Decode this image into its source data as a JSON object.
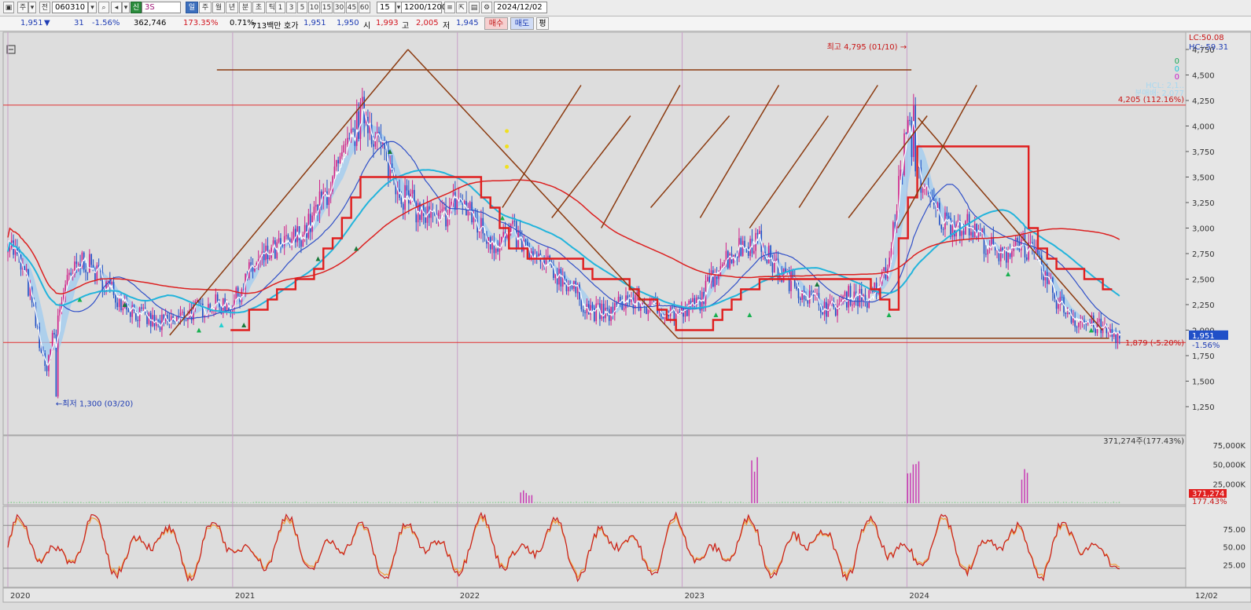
{
  "toolbar": {
    "code": "060310",
    "market_badge": "신",
    "name": "3S",
    "periods": [
      "일",
      "주",
      "월",
      "년",
      "분",
      "초",
      "틱"
    ],
    "active_period": "일",
    "intervals": [
      "1",
      "3",
      "5",
      "10",
      "15",
      "30",
      "45",
      "60"
    ],
    "interval_value": "15",
    "count": "1200/1200",
    "date": "2024/12/02",
    "left_labels": [
      "주",
      "전"
    ]
  },
  "quote": {
    "price": "1,951",
    "change_arrow": "▼",
    "change": "31",
    "change_pct": "-1.56%",
    "volume": "362,746",
    "volume_ratio": "173.35%",
    "turnover": "0.71%",
    "amount": "713백만",
    "bid_label": "호가",
    "ask": "1,951",
    "bid": "1,950",
    "open_label": "시",
    "open": "1,993",
    "high_label": "고",
    "high": "2,005",
    "low_label": "저",
    "low": "1,945",
    "buy_label": "매수",
    "sell_label": "매도",
    "eval_label": "평"
  },
  "main_panel": {
    "lc_label": "LC:50.08",
    "hc_label": "HC:-59.31",
    "legend_values": [
      "0",
      "0",
      "0"
    ],
    "legend_faded": [
      "HCL: 2,1..",
      "분매배: 2,077"
    ],
    "max_annotation": "최고 4,795 (01/10) →",
    "min_annotation": "←최저 1,300 (03/20)",
    "hline_upper_label": "4,205 (112.16%)",
    "hline_lower_label": "1,879 (-5.20%)",
    "price_badge": "1,951",
    "price_badge_sub": "-1.56%",
    "y_ticks": [
      "4,750",
      "4,500",
      "4,250",
      "4,000",
      "3,750",
      "3,500",
      "3,250",
      "3,000",
      "2,750",
      "2,500",
      "2,250",
      "2,000",
      "1,750",
      "1,500",
      "1,250"
    ]
  },
  "volume_panel": {
    "header": "371,274주(177.43%)",
    "y_ticks": [
      "75,000K",
      "50,000K",
      "25,000K"
    ],
    "badge": "371,274",
    "badge_sub": "177.43%"
  },
  "stoch_panel": {
    "y_ticks": [
      "75.00",
      "50.00",
      "25.00"
    ]
  },
  "x_axis": {
    "labels": [
      "2020",
      "2021",
      "2022",
      "2023",
      "2024",
      "12/02"
    ]
  },
  "colors": {
    "candle_body": "#d0208a",
    "ma_short": "#3050c8",
    "ma_long": "#22b4dc",
    "ma_red": "#dc2020",
    "trend": "#8b3a0f",
    "cloud": "#9ecbf0",
    "cloud_light": "#d4f4fa",
    "stoch_k": "#c81e1e",
    "stoch_d": "#f0a03c"
  },
  "chart_data": {
    "type": "candlestick",
    "x_range": [
      "2020-01",
      "2024-12-02"
    ],
    "ylim": [
      1250,
      4750
    ],
    "x": [
      "2020-01",
      "2020-02",
      "2020-03",
      "2020-04",
      "2020-05",
      "2020-06",
      "2020-07",
      "2020-08",
      "2020-09",
      "2020-10",
      "2020-11",
      "2020-12",
      "2021-01",
      "2021-02",
      "2021-03",
      "2021-04",
      "2021-05",
      "2021-06",
      "2021-07",
      "2021-08",
      "2021-09",
      "2021-10",
      "2021-11",
      "2021-12",
      "2022-01",
      "2022-02",
      "2022-03",
      "2022-04",
      "2022-05",
      "2022-06",
      "2022-07",
      "2022-08",
      "2022-09",
      "2022-10",
      "2022-11",
      "2022-12",
      "2023-01",
      "2023-02",
      "2023-03",
      "2023-04",
      "2023-05",
      "2023-06",
      "2023-07",
      "2023-08",
      "2023-09",
      "2023-10",
      "2023-11",
      "2023-12",
      "2024-01",
      "2024-02",
      "2024-03",
      "2024-04",
      "2024-05",
      "2024-06",
      "2024-07",
      "2024-08",
      "2024-09",
      "2024-10",
      "2024-11",
      "2024-12"
    ],
    "close": [
      2900,
      2500,
      1600,
      2400,
      2700,
      2500,
      2300,
      2150,
      2050,
      2100,
      2200,
      2250,
      2250,
      2600,
      2750,
      2850,
      3000,
      3350,
      3700,
      4150,
      3750,
      3350,
      3150,
      3050,
      3300,
      3050,
      2850,
      2950,
      2700,
      2600,
      2450,
      2200,
      2150,
      2300,
      2250,
      2200,
      2150,
      2300,
      2650,
      2800,
      2900,
      2600,
      2450,
      2300,
      2200,
      2350,
      2300,
      2600,
      4000,
      3300,
      3050,
      3050,
      2900,
      2700,
      2900,
      2650,
      2300,
      2100,
      2050,
      1951
    ],
    "price_panel": {
      "latest_price": 1951,
      "change": -31,
      "change_pct": -1.56,
      "max": {
        "value": 4795,
        "date": "01/10"
      },
      "min": {
        "value": 1300,
        "date": "03/20"
      },
      "horizontal_lines": [
        {
          "value": 4205,
          "pct": 112.16
        },
        {
          "value": 1879,
          "pct": -5.2
        }
      ]
    },
    "volume_panel": {
      "latest": 371274,
      "pct": 177.43,
      "ylim_k": [
        0,
        75000
      ]
    },
    "stochastic_panel": {
      "ylim": [
        0,
        100
      ],
      "levels": [
        20,
        80
      ]
    }
  }
}
